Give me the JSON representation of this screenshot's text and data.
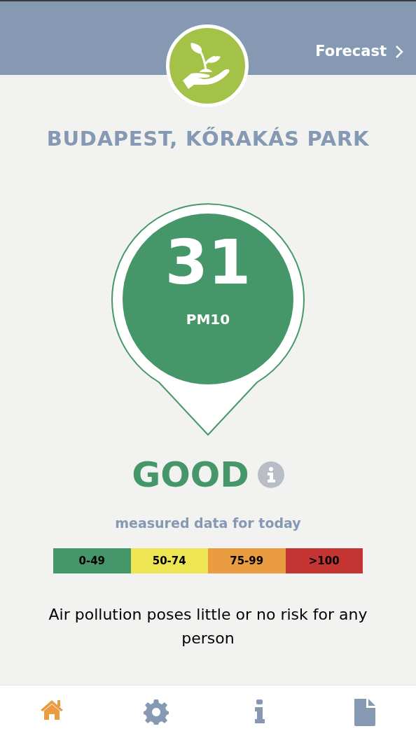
{
  "header": {
    "forecast_link": "Forecast"
  },
  "station": {
    "title": "BUDAPEST, KŐRAKÁS PARK"
  },
  "reading": {
    "value": "31",
    "unit": "PM10"
  },
  "rating": {
    "label": "GOOD"
  },
  "subtitle": "measured data for today",
  "scale": [
    {
      "label": "0-49",
      "color": "#45976a"
    },
    {
      "label": "50-74",
      "color": "#eee552"
    },
    {
      "label": "75-99",
      "color": "#e99c40"
    },
    {
      "label": ">100",
      "color": "#c43432"
    }
  ],
  "description": "Air pollution poses little or no risk for any person",
  "nav": [
    {
      "kind": "home",
      "selected": true
    },
    {
      "kind": "settings",
      "selected": false
    },
    {
      "kind": "info",
      "selected": false
    },
    {
      "kind": "document",
      "selected": false
    }
  ]
}
